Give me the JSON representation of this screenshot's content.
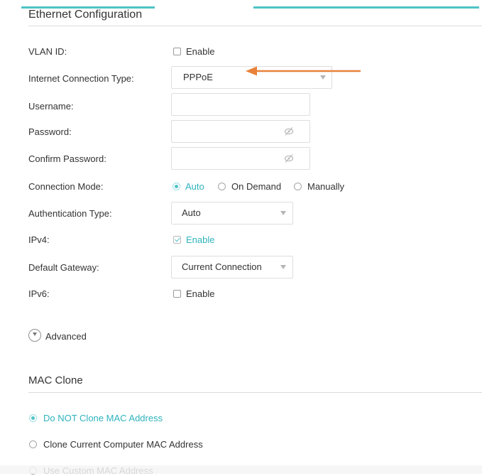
{
  "ethernet": {
    "title": "Ethernet Configuration",
    "vlan": {
      "label": "VLAN ID:",
      "checkbox_label": "Enable",
      "checked": false
    },
    "connection_type": {
      "label": "Internet Connection Type:",
      "value": "PPPoE"
    },
    "username": {
      "label": "Username:",
      "value": ""
    },
    "password": {
      "label": "Password:",
      "value": ""
    },
    "confirm_password": {
      "label": "Confirm Password:",
      "value": ""
    },
    "connection_mode": {
      "label": "Connection Mode:",
      "options": [
        "Auto",
        "On Demand",
        "Manually"
      ],
      "selected": "Auto"
    },
    "auth_type": {
      "label": "Authentication Type:",
      "value": "Auto"
    },
    "ipv4": {
      "label": "IPv4:",
      "checkbox_label": "Enable",
      "checked": true
    },
    "default_gateway": {
      "label": "Default Gateway:",
      "value": "Current Connection"
    },
    "ipv6": {
      "label": "IPv6:",
      "checkbox_label": "Enable",
      "checked": false
    },
    "advanced_label": "Advanced"
  },
  "mac_clone": {
    "title": "MAC Clone",
    "options": [
      "Do NOT Clone MAC Address",
      "Clone Current Computer MAC Address",
      "Use Custom MAC Address"
    ],
    "selected": "Do NOT Clone MAC Address"
  },
  "colors": {
    "accent": "#4fc3c7",
    "annotation_arrow": "#e8823a"
  },
  "icons": {
    "password_toggle": "eye-slash-icon",
    "advanced_toggle": "chevron-down-circle-icon"
  }
}
